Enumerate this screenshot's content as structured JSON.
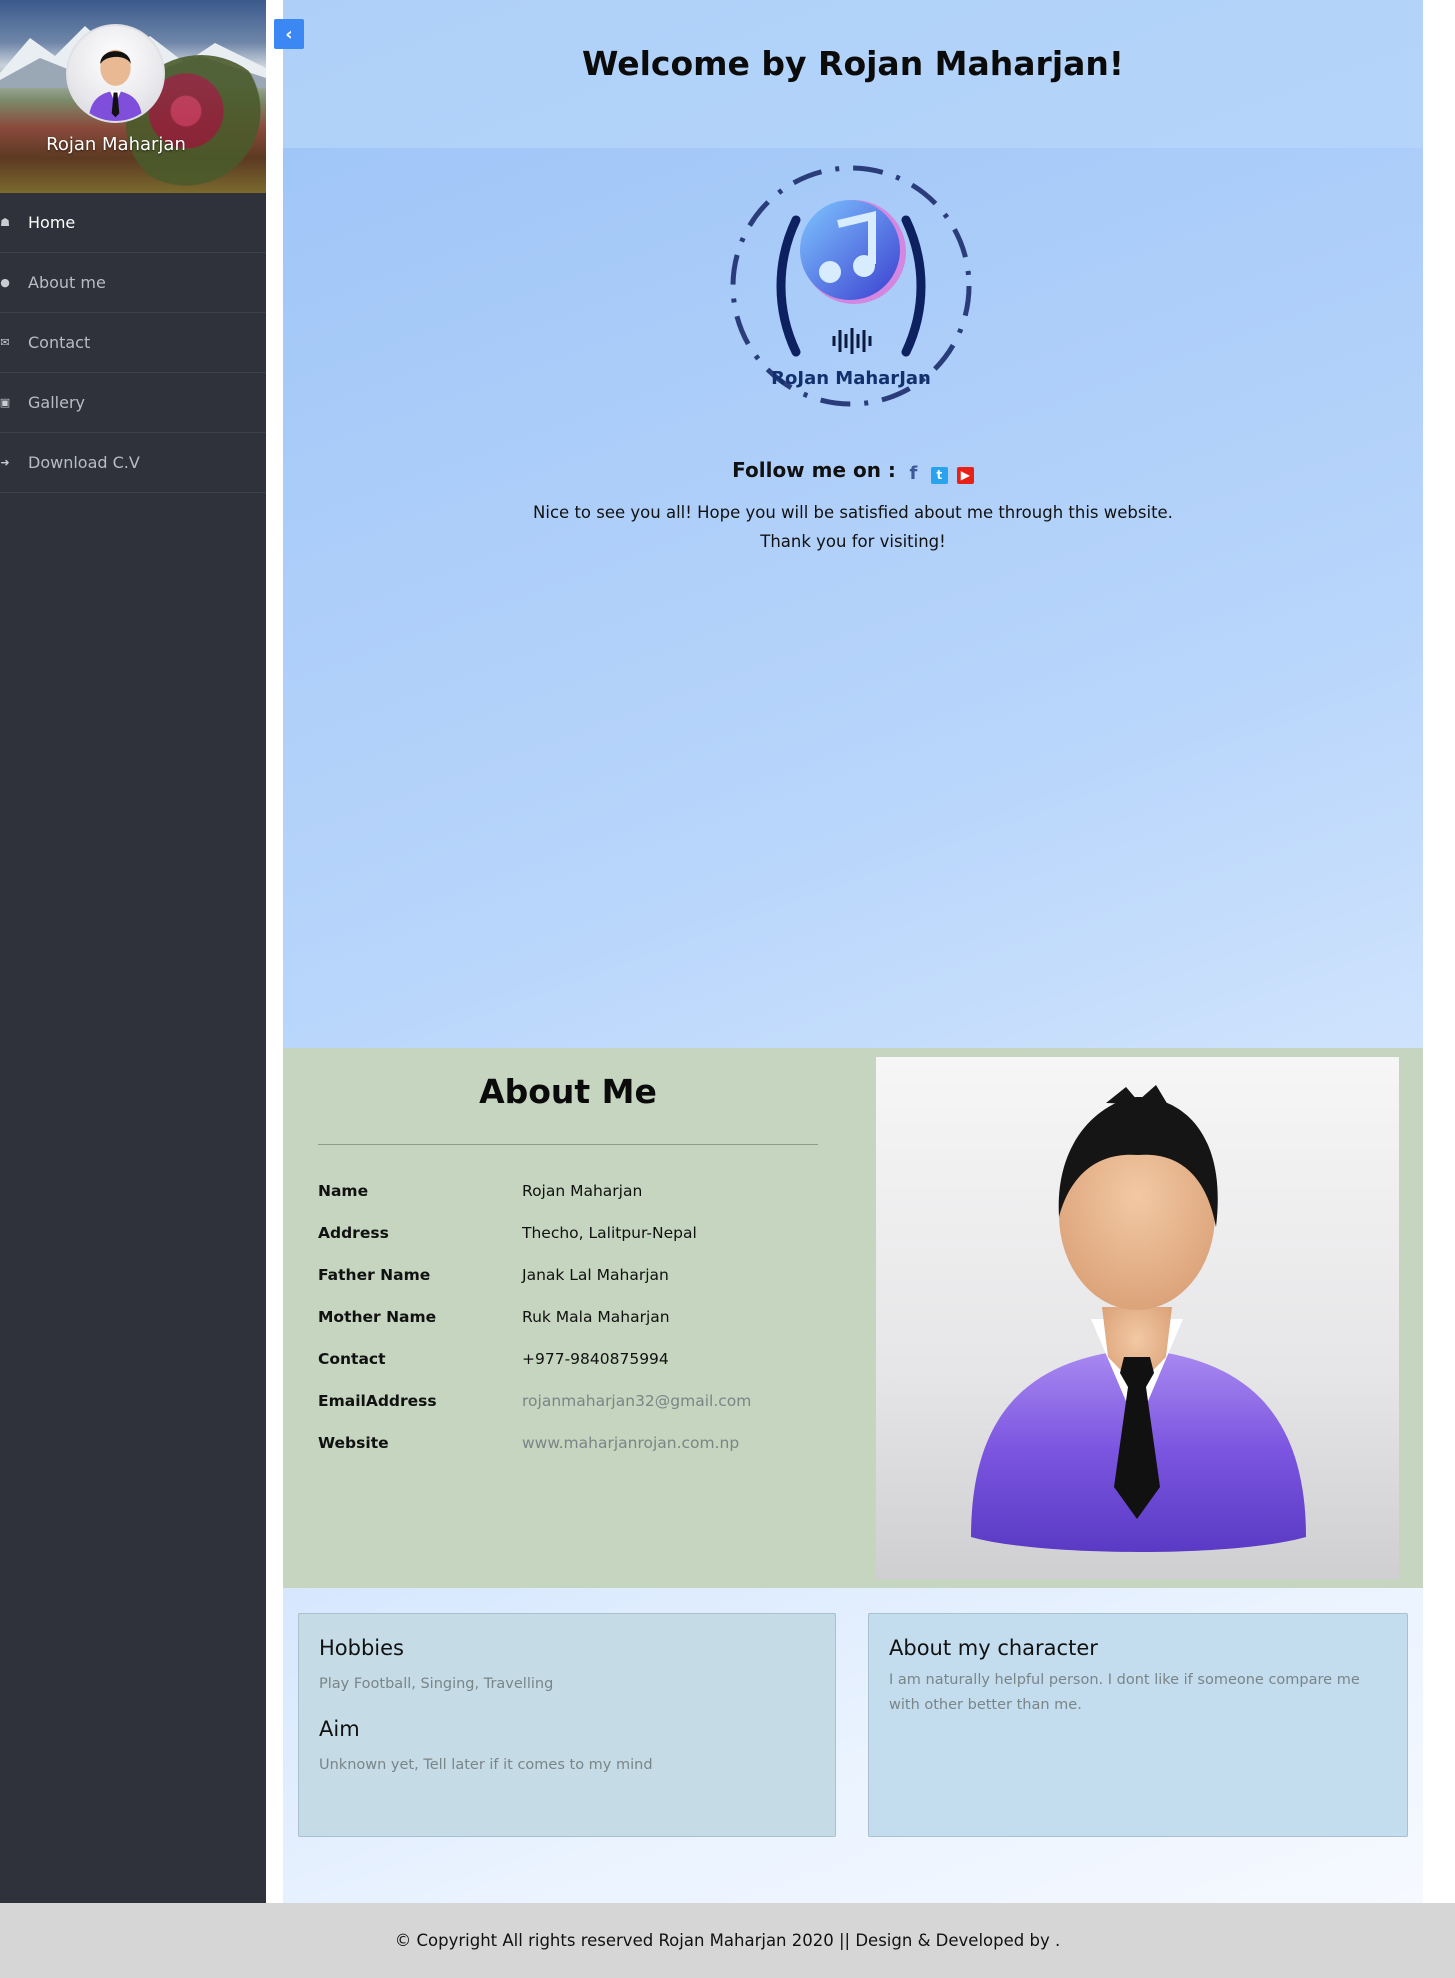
{
  "sidebar": {
    "name": "Rojan Maharjan",
    "items": [
      {
        "label": "Home",
        "icon": "home-icon"
      },
      {
        "label": "About me",
        "icon": "user-icon"
      },
      {
        "label": "Contact",
        "icon": "envelope-icon"
      },
      {
        "label": "Gallery",
        "icon": "image-icon"
      },
      {
        "label": "Download C.V",
        "icon": "download-icon"
      }
    ]
  },
  "hero": {
    "title": "Welcome by Rojan Maharjan!",
    "logo_text": "RoJan MaharJan",
    "follow_label": "Follow me on :",
    "line1": "Nice to see you all! Hope you will be satisfied about me through this website.",
    "line2": "Thank you for visiting!"
  },
  "about": {
    "title": "About Me",
    "rows": [
      {
        "key": "Name",
        "value": "Rojan Maharjan"
      },
      {
        "key": "Address",
        "value": "Thecho, Lalitpur-Nepal"
      },
      {
        "key": "Father Name",
        "value": "Janak Lal Maharjan"
      },
      {
        "key": "Mother Name",
        "value": "Ruk Mala Maharjan"
      },
      {
        "key": "Contact",
        "value": "+977-9840875994"
      },
      {
        "key": "EmailAddress",
        "value": "rojanmaharjan32@gmail.com"
      },
      {
        "key": "Website",
        "value": "www.maharjanrojan.com.np"
      }
    ]
  },
  "cards": {
    "hobbies_title": "Hobbies",
    "hobbies_text": "Play Football, Singing, Travelling",
    "aim_title": "Aim",
    "aim_text": "Unknown yet, Tell later if it comes to my mind",
    "character_title": "About my character",
    "character_text": "I am naturally helpful person. I dont like if someone compare me with other better than me."
  },
  "footer": {
    "text": "© Copyright All rights reserved Rojan Maharjan 2020 || Design & Developed by ."
  },
  "colors": {
    "sidebar_bg": "#2f323b",
    "toggle_blue": "#3b87f3",
    "about_bg": "#c5d5bf",
    "footer_bg": "#d6d6d6"
  }
}
